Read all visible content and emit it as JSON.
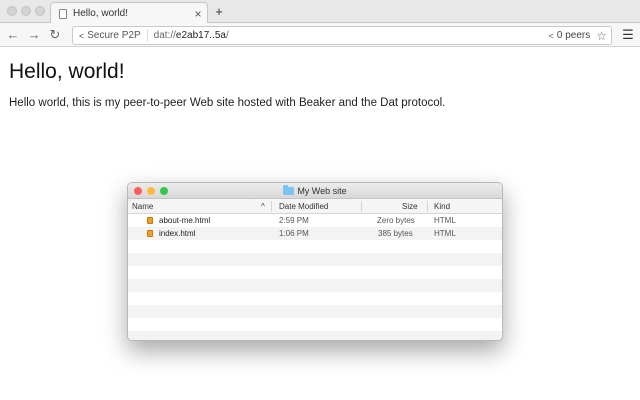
{
  "tab": {
    "title": "Hello, world!",
    "close": "×",
    "new_tab": "+"
  },
  "toolbar": {
    "back": "←",
    "forward": "→",
    "reload": "↻",
    "secure_label": "Secure P2P",
    "url_prefix": "dat://",
    "url_host": "e2ab17..5a",
    "url_suffix": "/",
    "peers_label": "0 peers",
    "star": "☆",
    "menu": "☰"
  },
  "content": {
    "heading": "Hello, world!",
    "paragraph": "Hello world, this is my peer-to-peer Web site hosted with Beaker and the Dat protocol."
  },
  "finder": {
    "title": "My Web site",
    "columns": {
      "name": "Name",
      "sort": "^",
      "date": "Date Modified",
      "size": "Size",
      "kind": "Kind"
    },
    "files": [
      {
        "name": "about-me.html",
        "date": "2:59 PM",
        "size": "Zero bytes",
        "kind": "HTML"
      },
      {
        "name": "index.html",
        "date": "1:06 PM",
        "size": "385 bytes",
        "kind": "HTML"
      }
    ],
    "colors": {
      "close": "#fc605b",
      "minimize": "#fdbc40",
      "zoom": "#34c84a",
      "folder": "#7ec4f2"
    }
  }
}
